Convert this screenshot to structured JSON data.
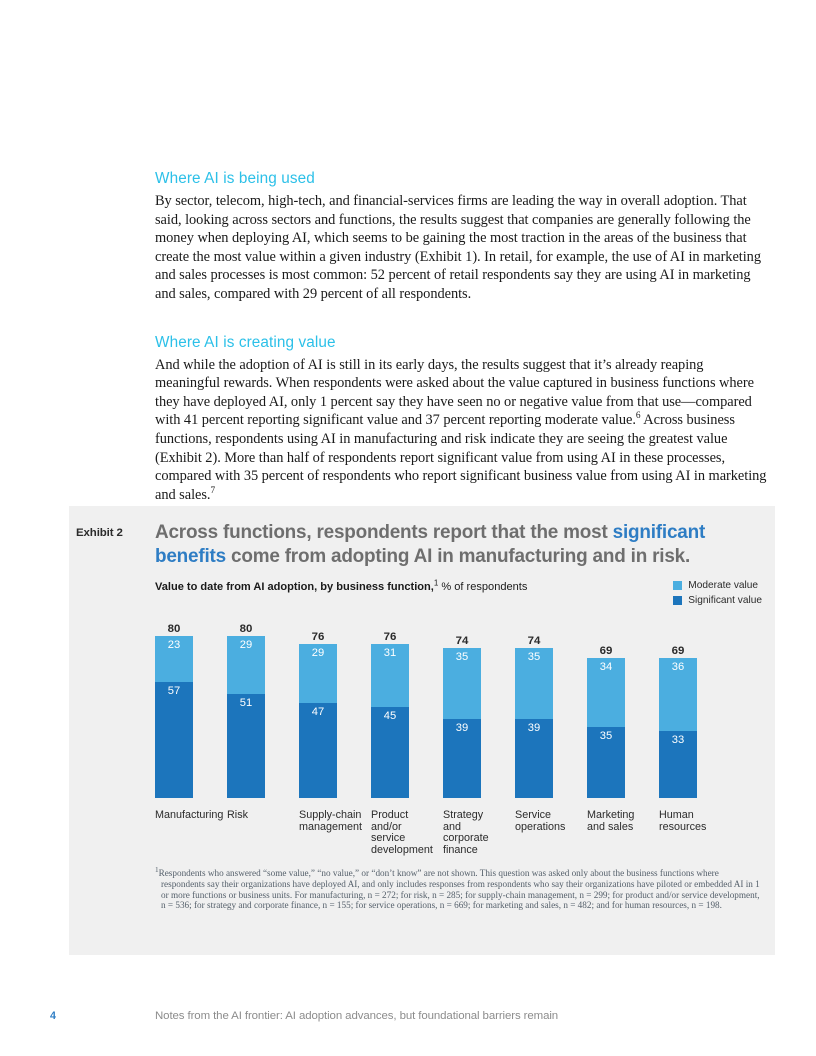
{
  "article": {
    "sections": [
      {
        "heading": "Where AI is being used",
        "body": "By sector, telecom, high-tech, and financial-services firms are leading the way in overall adoption. That said, looking across sectors and functions, the results suggest that companies are generally following the money when deploying AI, which seems to be gaining the most traction in the areas of the business that create the most value within a given industry (Exhibit 1). In retail, for example, the use of AI in marketing and sales processes is most common: 52 percent of retail respondents say they are using AI in marketing and sales, compared with 29 percent of all respondents."
      },
      {
        "heading": "Where AI is creating value",
        "body_part1": "And while the adoption of AI is still in its early days, the results suggest that it’s already reaping meaningful rewards. When respondents were asked about the value captured in business functions where they have deployed AI, only 1 percent say they have seen no or negative value from that use—compared with 41 percent reporting significant value and 37 percent reporting moderate value.",
        "footnote_ref1": "6",
        "body_part2": " Across business functions, respondents using AI in manufacturing and risk indicate they are seeing the greatest value (Exhibit 2). More than half of respondents report significant value from using AI in these processes, compared with 35 percent of respondents who report significant business value from using AI in marketing and sales.",
        "footnote_ref2": "7"
      }
    ]
  },
  "exhibit": {
    "label": "Exhibit 2",
    "title_part1": "Across functions, respondents report that the most ",
    "title_highlight1": "significant benefits",
    "title_part2": " come from adopting AI in manufacturing and in risk.",
    "subtitle_bold": "Value to date from AI adoption, by business function,",
    "subtitle_sup": "1",
    "subtitle_light": " % of respondents",
    "footnote_marker": "1",
    "footnote": "Respondents who answered “some value,” “no value,” or “don’t know” are not shown. This question was asked only about the business functions where respondents say their organizations have deployed AI, and only includes responses from respondents who say their organizations have piloted or embedded AI in 1 or more functions or business units. For manufacturing, n = 272; for risk, n = 285; for supply-chain management, n = 299; for product and/or service development, n = 536; for strategy and corporate finance, n = 155; for service operations, n = 669; for marketing and sales, n = 482; and for human resources, n = 198."
  },
  "chart_data": {
    "type": "bar",
    "subtype": "stacked-vertical",
    "title": "Value to date from AI adoption, by business function",
    "ylabel": "% of respondents",
    "xlabel": "",
    "ylim": [
      0,
      80
    ],
    "grid": false,
    "legend_position": "top-right",
    "colors": {
      "moderate": "#4BAEE0",
      "significant": "#1C75BC"
    },
    "legend": [
      {
        "name": "Moderate value",
        "color": "#4BAEE0"
      },
      {
        "name": "Significant value",
        "color": "#1C75BC"
      }
    ],
    "categories": [
      "Manufacturing",
      "Risk",
      "Supply-chain management",
      "Product and/or service development",
      "Strategy and corporate finance",
      "Service operations",
      "Marketing and sales",
      "Human resources"
    ],
    "series": [
      {
        "name": "Significant value",
        "color": "#1C75BC",
        "values": [
          57,
          51,
          47,
          45,
          39,
          39,
          35,
          33
        ]
      },
      {
        "name": "Moderate value",
        "color": "#4BAEE0",
        "values": [
          23,
          29,
          29,
          31,
          35,
          35,
          34,
          36
        ]
      }
    ],
    "totals": [
      80,
      80,
      76,
      76,
      74,
      74,
      69,
      69
    ],
    "bars": [
      {
        "category": "Manufacturing",
        "label_lines": [
          "Manufacturing"
        ],
        "significant": 57,
        "moderate": 23,
        "total": 80
      },
      {
        "category": "Risk",
        "label_lines": [
          "Risk"
        ],
        "significant": 51,
        "moderate": 29,
        "total": 80
      },
      {
        "category": "Supply-chain management",
        "label_lines": [
          "Supply-chain",
          "management"
        ],
        "significant": 47,
        "moderate": 29,
        "total": 76
      },
      {
        "category": "Product and/or service development",
        "label_lines": [
          "Product",
          "and/or",
          "service",
          "development"
        ],
        "significant": 45,
        "moderate": 31,
        "total": 76
      },
      {
        "category": "Strategy and corporate finance",
        "label_lines": [
          "Strategy",
          "and",
          "corporate",
          "finance"
        ],
        "significant": 39,
        "moderate": 35,
        "total": 74
      },
      {
        "category": "Service operations",
        "label_lines": [
          "Service",
          "operations"
        ],
        "significant": 39,
        "moderate": 35,
        "total": 74
      },
      {
        "category": "Marketing and sales",
        "label_lines": [
          "Marketing",
          "and sales"
        ],
        "significant": 35,
        "moderate": 34,
        "total": 69
      },
      {
        "category": "Human resources",
        "label_lines": [
          "Human",
          "resources"
        ],
        "significant": 33,
        "moderate": 36,
        "total": 69
      }
    ]
  },
  "page_footer": {
    "page_number": "4",
    "running_title": "Notes from the AI frontier: AI adoption advances, but foundational barriers remain"
  }
}
